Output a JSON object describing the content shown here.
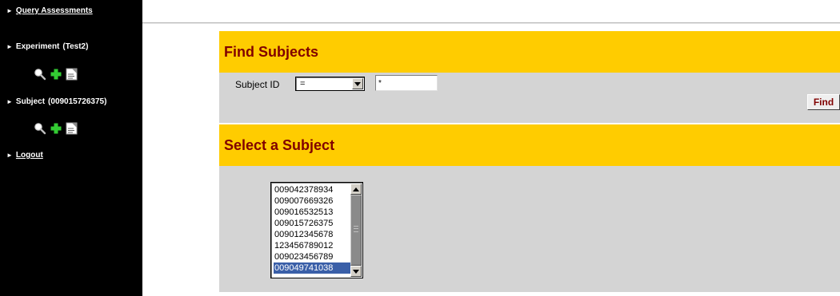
{
  "sidebar": {
    "nav": {
      "query": "Query Assessments",
      "experiment_label": "Experiment",
      "experiment_value": "(Test2)",
      "subject_label": "Subject",
      "subject_value": "(009015726375)",
      "logout": "Logout"
    },
    "icons": [
      "magnifier-icon",
      "plus-icon",
      "document-icon"
    ]
  },
  "find_panel": {
    "title": "Find Subjects",
    "field_label": "Subject ID",
    "operator_value": "=",
    "input_value": "*",
    "find_button": "Find"
  },
  "select_panel": {
    "title": "Select a Subject",
    "subjects": [
      "009042378934",
      "009007669326",
      "009016532513",
      "009015726375",
      "009012345678",
      "123456789012",
      "009023456789",
      "009049741038"
    ],
    "selected": "009049741038"
  },
  "colors": {
    "sidebar_bg": "#000000",
    "header_bg": "#ffcc00",
    "header_text": "#800000",
    "panel_bg": "#d4d4d4",
    "selection": "#3a5fa8"
  }
}
